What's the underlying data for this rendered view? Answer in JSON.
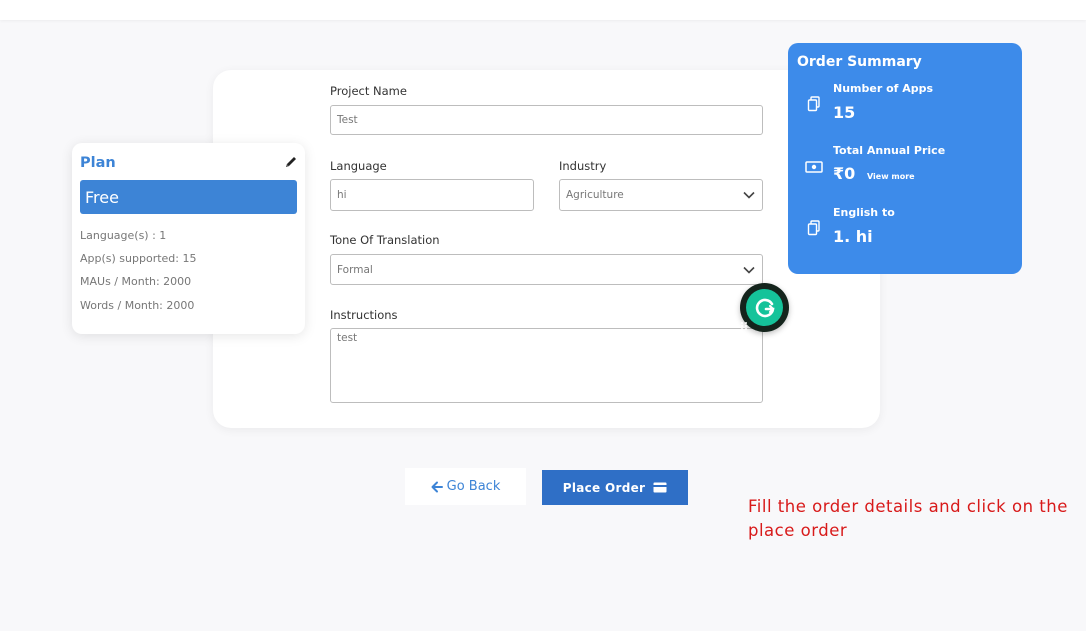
{
  "form": {
    "project_name_label": "Project Name",
    "project_name_value": "Test",
    "language_label": "Language",
    "language_value": "hi",
    "industry_label": "Industry",
    "industry_value": "Agriculture",
    "tone_label": "Tone Of Translation",
    "tone_value": "Formal",
    "instructions_label": "Instructions",
    "instructions_value": "test"
  },
  "plan": {
    "title": "Plan",
    "name": "Free",
    "details": [
      "Language(s) : 1",
      "App(s) supported: 15",
      "MAUs / Month: 2000",
      "Words / Month: 2000"
    ]
  },
  "summary": {
    "title": "Order Summary",
    "apps_label": "Number of Apps",
    "apps_value": "15",
    "price_label": "Total Annual Price",
    "price_value": "₹0",
    "view_more": "View more",
    "lang_label": "English to",
    "lang_value": "1. hi"
  },
  "actions": {
    "go_back": "Go Back",
    "place_order": "Place Order"
  },
  "annotation": "Fill the order details and click on the place order",
  "colors": {
    "accent": "#3d84d6",
    "summary_bg": "#3d8bea",
    "button": "#2f6fc6",
    "annotation": "#d81a1a",
    "grammarly": "#15c39a"
  },
  "icons": [
    "pencil-icon",
    "copy-icon",
    "money-icon",
    "chevron-down-icon",
    "arrow-left-icon",
    "credit-card-icon",
    "grammarly-icon"
  ]
}
